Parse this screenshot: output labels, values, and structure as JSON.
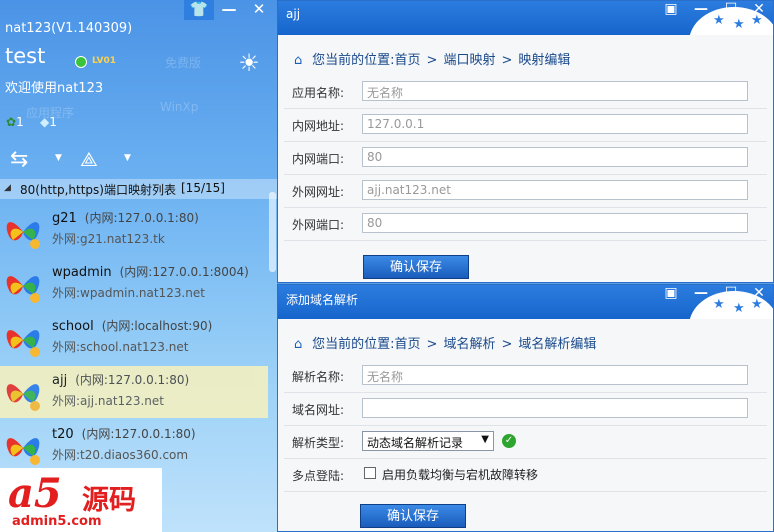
{
  "client": {
    "app_title": "nat123(V1.140309)",
    "username": "test",
    "level": "LV01",
    "welcome": "欢迎使用nat123",
    "stat1": "1",
    "stat2": "1",
    "ghost1": "免费版",
    "ghost2": "WinXp",
    "ghost3": "应用程序",
    "group": {
      "label": "80(http,https)端口映射列表",
      "count": "[15/15]"
    },
    "items": [
      {
        "name": "g21",
        "inner": "(内网:127.0.0.1:80)",
        "outer": "外网:g21.nat123.tk"
      },
      {
        "name": "wpadmin",
        "inner": "(内网:127.0.0.1:8004)",
        "outer": "外网:wpadmin.nat123.net"
      },
      {
        "name": "school",
        "inner": "(内网:localhost:90)",
        "outer": "外网:school.nat123.net"
      },
      {
        "name": "ajj",
        "inner": "(内网:127.0.0.1:80)",
        "outer": "外网:ajj.nat123.net"
      },
      {
        "name": "t20",
        "inner": "(内网:127.0.0.1:80)",
        "outer": "外网:t20.diaos360.com"
      }
    ],
    "logo": {
      "mark": "a5",
      "text": "源码",
      "url": "admin5.com"
    }
  },
  "win1": {
    "title": "ajj",
    "crumb": {
      "prefix": "您当前的位置:",
      "c1": "首页",
      "c2": "端口映射",
      "c3": "映射编辑"
    },
    "fields": [
      {
        "label": "应用名称:",
        "value": "无名称"
      },
      {
        "label": "内网地址:",
        "value": "127.0.0.1"
      },
      {
        "label": "内网端口:",
        "value": "80"
      },
      {
        "label": "外网网址:",
        "value": "ajj.nat123.net"
      },
      {
        "label": "外网端口:",
        "value": "80"
      }
    ],
    "save": "确认保存"
  },
  "win2": {
    "title": "添加域名解析",
    "crumb": {
      "prefix": "您当前的位置:",
      "c1": "首页",
      "c2": "域名解析",
      "c3": "域名解析编辑"
    },
    "name_label": "解析名称:",
    "name_value": "无名称",
    "domain_label": "域名网址:",
    "domain_value": "",
    "type_label": "解析类型:",
    "type_value": "动态域名解析记录",
    "multi_label": "多点登陆:",
    "multi_option": "启用负载均衡与宕机故障转移",
    "save": "确认保存"
  },
  "colors": {
    "accent": "#1565cc",
    "selected": "#f3f0c0"
  }
}
